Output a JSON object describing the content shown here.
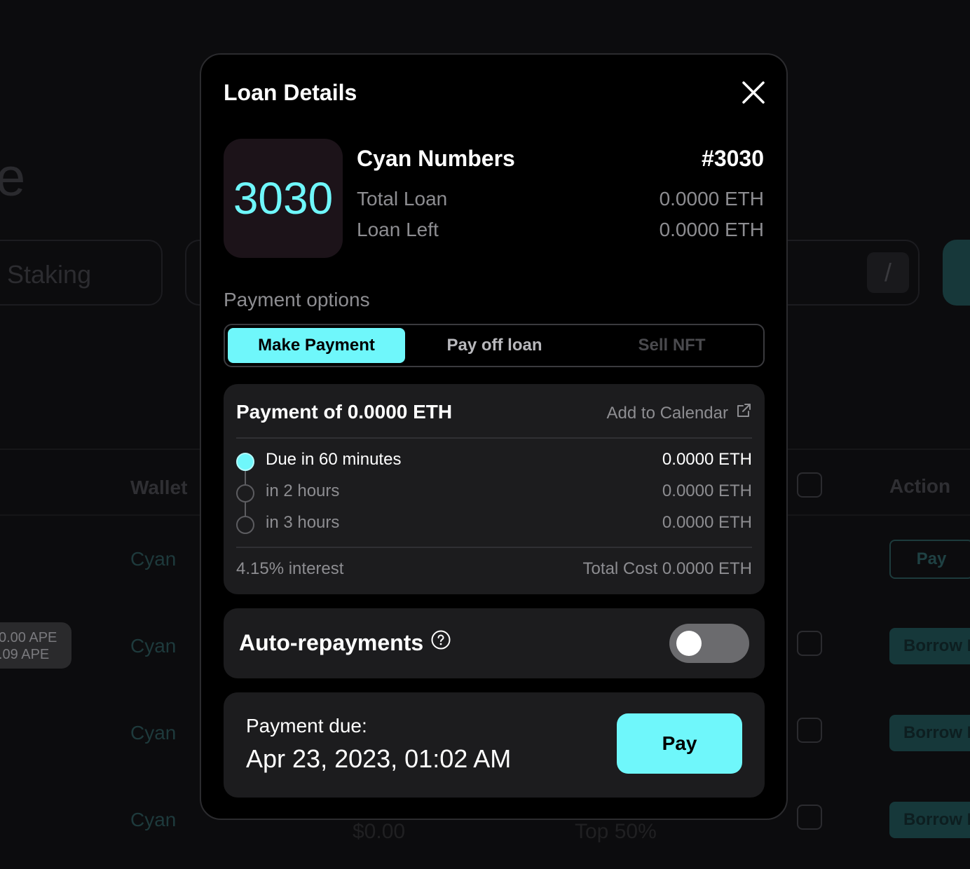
{
  "background": {
    "header_partial": "e",
    "vault_label": "ult Staking",
    "search_shortcut": "/",
    "col_wallet": "Wallet",
    "col_action": "Action",
    "wallets": [
      "Cyan",
      "Cyan",
      "Cyan",
      "Cyan"
    ],
    "ape_line1": "0.00 APE",
    "ape_line2": ".09 APE",
    "pay_label": "Pay",
    "borrow_label": "Borrow I",
    "footer_price": "$0.00",
    "footer_rank": "Top 50%"
  },
  "modal": {
    "title": "Loan Details",
    "close_icon": "close-icon",
    "nft": {
      "thumb_text": "3030",
      "collection": "Cyan Numbers",
      "token_id": "#3030",
      "total_loan_label": "Total Loan",
      "total_loan_value": "0.0000 ETH",
      "loan_left_label": "Loan Left",
      "loan_left_value": "0.0000 ETH"
    },
    "payment_options_label": "Payment options",
    "tabs": [
      {
        "label": "Make Payment",
        "active": true
      },
      {
        "label": "Pay off loan",
        "active": false
      },
      {
        "label": "Sell NFT",
        "active": false
      }
    ],
    "payment": {
      "title": "Payment of 0.0000 ETH",
      "calendar_label": "Add to Calendar",
      "schedule": [
        {
          "label": "Due in 60 minutes",
          "value": "0.0000 ETH"
        },
        {
          "label": "in 2 hours",
          "value": "0.0000 ETH"
        },
        {
          "label": "in 3 hours",
          "value": "0.0000 ETH"
        }
      ],
      "interest": "4.15% interest",
      "total_cost": "Total Cost 0.0000 ETH"
    },
    "auto_repayments": {
      "label": "Auto-repayments",
      "enabled": false
    },
    "due": {
      "label": "Payment due:",
      "date": "Apr 23, 2023, 01:02 AM",
      "pay_button": "Pay"
    },
    "accent_color": "#6ff7fb"
  }
}
